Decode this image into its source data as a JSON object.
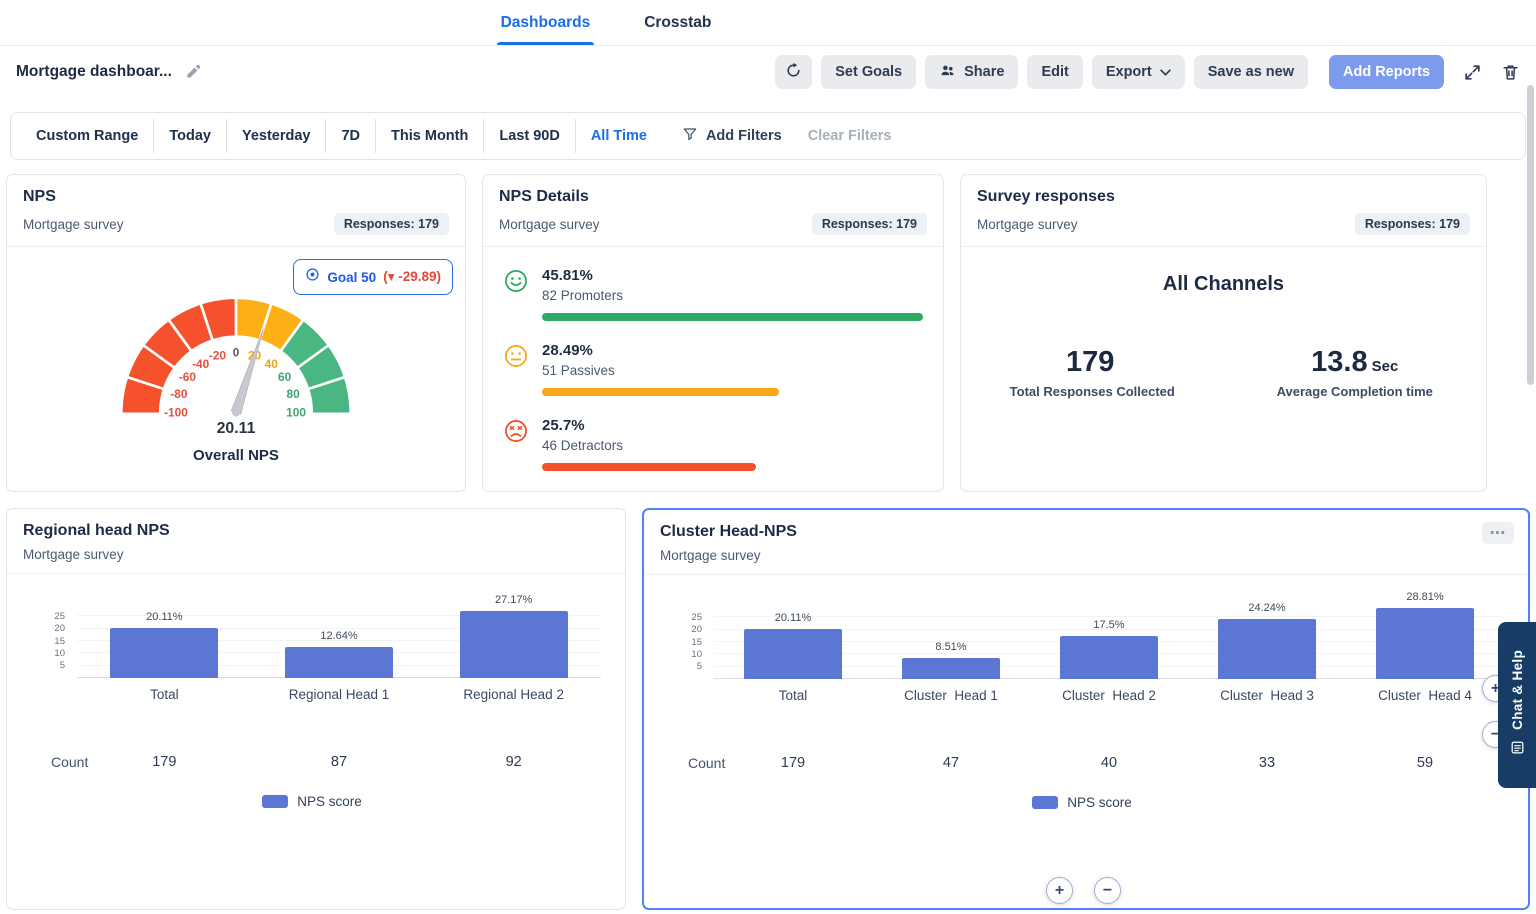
{
  "nav": {
    "tabs": [
      {
        "label": "Dashboards",
        "active": true
      },
      {
        "label": "Crosstab",
        "active": false
      }
    ]
  },
  "toolbar": {
    "title": "Mortgage dashboar...",
    "set_goals": "Set Goals",
    "share": "Share",
    "edit": "Edit",
    "export": "Export",
    "save_as_new": "Save as new",
    "add_reports": "Add Reports"
  },
  "filter_bar": {
    "ranges": [
      "Custom Range",
      "Today",
      "Yesterday",
      "7D",
      "This Month",
      "Last 90D",
      "All Time"
    ],
    "active_range": "All Time",
    "add_filters_label": "Add Filters",
    "clear_filters_label": "Clear Filters"
  },
  "nps_card": {
    "title": "NPS",
    "subtitle": "Mortgage survey",
    "responses_badge": "Responses: 179",
    "goal_label": "Goal 50",
    "goal_delta": "(▾ -29.89)"
  },
  "nps_details_card": {
    "title": "NPS Details",
    "subtitle": "Mortgage survey",
    "responses_badge": "Responses: 179",
    "rows": [
      {
        "type": "promoters",
        "pct": 45.81,
        "pct_label": "45.81%",
        "label": "82 Promoters",
        "color": "#2eaa66"
      },
      {
        "type": "passives",
        "pct": 28.49,
        "pct_label": "28.49%",
        "label": "51 Passives",
        "color": "#f7a81b"
      },
      {
        "type": "detractors",
        "pct": 25.7,
        "pct_label": "25.7%",
        "label": "46 Detractors",
        "color": "#f4502c"
      }
    ]
  },
  "survey_card": {
    "title": "Survey responses",
    "subtitle": "Mortgage survey",
    "responses_badge": "Responses: 179",
    "channel_label": "All Channels",
    "stats": [
      {
        "value": "179",
        "unit": "",
        "label": "Total Responses Collected"
      },
      {
        "value": "13.8",
        "unit": "Sec",
        "label": "Average Completion time"
      }
    ]
  },
  "regional_card": {
    "title": "Regional head NPS",
    "subtitle": "Mortgage survey"
  },
  "cluster_card": {
    "title": "Cluster Head-NPS",
    "subtitle": "Mortgage survey"
  },
  "chat_help": {
    "label": "Chat & Help"
  },
  "icons": {
    "menu_dots": "⋯",
    "zoom_in": "+",
    "zoom_out": "−"
  },
  "chart_data": [
    {
      "id": "nps_gauge",
      "type": "gauge",
      "title": "NPS",
      "value": 20.11,
      "value_label": "20.11",
      "caption": "Overall NPS",
      "min": -100,
      "max": 100,
      "ticks": [
        -100,
        -80,
        -60,
        -40,
        -20,
        0,
        20,
        40,
        60,
        80,
        100
      ],
      "zones": [
        {
          "from": -100,
          "to": 0,
          "color": "#f4512c"
        },
        {
          "from": 0,
          "to": 40,
          "color": "#fcb016"
        },
        {
          "from": 40,
          "to": 100,
          "color": "#4ab783"
        }
      ]
    },
    {
      "id": "regional",
      "type": "bar",
      "title": "Regional head NPS",
      "categories": [
        "Total",
        "Regional Head 1",
        "Regional Head 2"
      ],
      "values": [
        20.11,
        12.64,
        27.17
      ],
      "value_labels": [
        "20.11%",
        "12.64%",
        "27.17%"
      ],
      "counts": [
        "179",
        "87",
        "92"
      ],
      "count_label": "Count",
      "yticks": [
        25,
        20,
        15,
        10,
        5
      ],
      "ymax": 30,
      "bar_color": "#5b76d3",
      "legend": "NPS score"
    },
    {
      "id": "cluster",
      "type": "bar",
      "title": "Cluster Head-NPS",
      "categories": [
        "Total",
        "Cluster  Head 1",
        "Cluster  Head 2",
        "Cluster  Head 3",
        "Cluster  Head 4"
      ],
      "values": [
        20.11,
        8.51,
        17.5,
        24.24,
        28.81
      ],
      "value_labels": [
        "20.11%",
        "8.51%",
        "17.5%",
        "24.24%",
        "28.81%"
      ],
      "counts": [
        "179",
        "47",
        "40",
        "33",
        "59"
      ],
      "count_label": "Count",
      "yticks": [
        25,
        20,
        15,
        10,
        5
      ],
      "ymax": 30,
      "bar_color": "#5b76d3",
      "legend": "NPS score"
    }
  ]
}
